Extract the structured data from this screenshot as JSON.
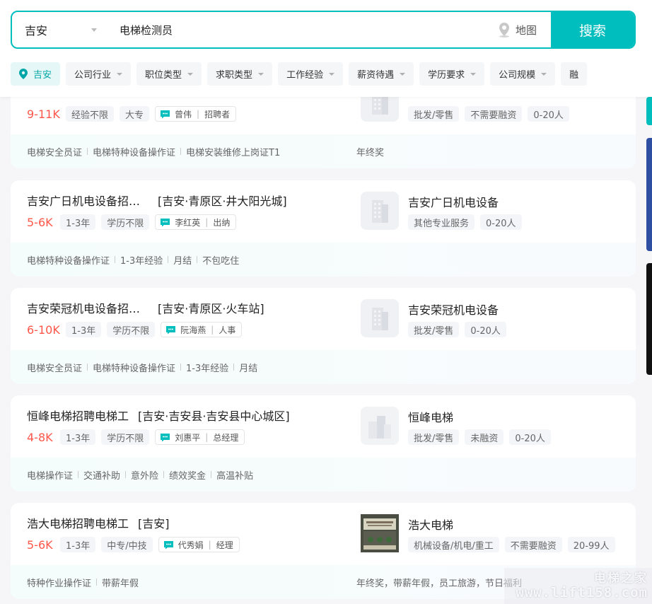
{
  "search": {
    "city": "吉安",
    "keyword": "电梯检测员",
    "map_label": "地图",
    "button_label": "搜索"
  },
  "filters": {
    "location": "吉安",
    "items": [
      "公司行业",
      "职位类型",
      "求职类型",
      "工作经验",
      "薪资待遇",
      "学历要求",
      "公司规模",
      "融"
    ]
  },
  "jobs": [
    {
      "title": "",
      "area": "",
      "salary": "9-11K",
      "tags": [
        "经验不限",
        "大专"
      ],
      "recruiter_name": "曾伟",
      "recruiter_role": "招聘者",
      "company_name": "",
      "company_tags": [
        "批发/零售",
        "不需要融资",
        "0-20人"
      ],
      "skills": [
        "电梯安全员证",
        "电梯特种设备操作证",
        "电梯安装维修上岗证T1"
      ],
      "welfare": "年终奖"
    },
    {
      "title": "吉安广日机电设备招…",
      "area": "[吉安·青原区·井大阳光城]",
      "salary": "5-6K",
      "tags": [
        "1-3年",
        "学历不限"
      ],
      "recruiter_name": "李红英",
      "recruiter_role": "出纳",
      "company_name": "吉安广日机电设备",
      "company_tags": [
        "其他专业服务",
        "0-20人"
      ],
      "skills": [
        "电梯特种设备操作证",
        "1-3年经验",
        "月结",
        "不包吃住"
      ],
      "welfare": ""
    },
    {
      "title": "吉安荣冠机电设备招…",
      "area": "[吉安·青原区·火车站]",
      "salary": "6-10K",
      "tags": [
        "1-3年",
        "学历不限"
      ],
      "recruiter_name": "阮海燕",
      "recruiter_role": "人事",
      "company_name": "吉安荣冠机电设备",
      "company_tags": [
        "批发/零售",
        "0-20人"
      ],
      "skills": [
        "电梯安全员证",
        "电梯特种设备操作证",
        "1-3年经验",
        "月结"
      ],
      "welfare": ""
    },
    {
      "title": "恒峰电梯招聘电梯工",
      "area": "[吉安·吉安县·吉安县中心城区]",
      "salary": "4-8K",
      "tags": [
        "1-3年",
        "学历不限"
      ],
      "recruiter_name": "刘惠平",
      "recruiter_role": "总经理",
      "company_name": "恒峰电梯",
      "company_tags": [
        "批发/零售",
        "未融资",
        "0-20人"
      ],
      "skills": [
        "电梯操作证",
        "交通补助",
        "意外险",
        "绩效奖金",
        "高温补贴"
      ],
      "welfare": ""
    },
    {
      "title": "浩大电梯招聘电梯工",
      "area": "[吉安]",
      "salary": "5-6K",
      "tags": [
        "1-3年",
        "中专/中技"
      ],
      "recruiter_name": "代秀娟",
      "recruiter_role": "经理",
      "company_name": "浩大电梯",
      "company_tags": [
        "机械设备/机电/重工",
        "不需要融资",
        "20-99人"
      ],
      "skills": [
        "特种作业操作证",
        "带薪年假"
      ],
      "welfare": "年终奖，带薪年假，员工旅游，节日福利"
    }
  ],
  "watermark": {
    "line1": "电梯之家",
    "line2": "www.lift158.com"
  },
  "colors": {
    "accent": "#00bebd",
    "salary": "#fe574a"
  }
}
